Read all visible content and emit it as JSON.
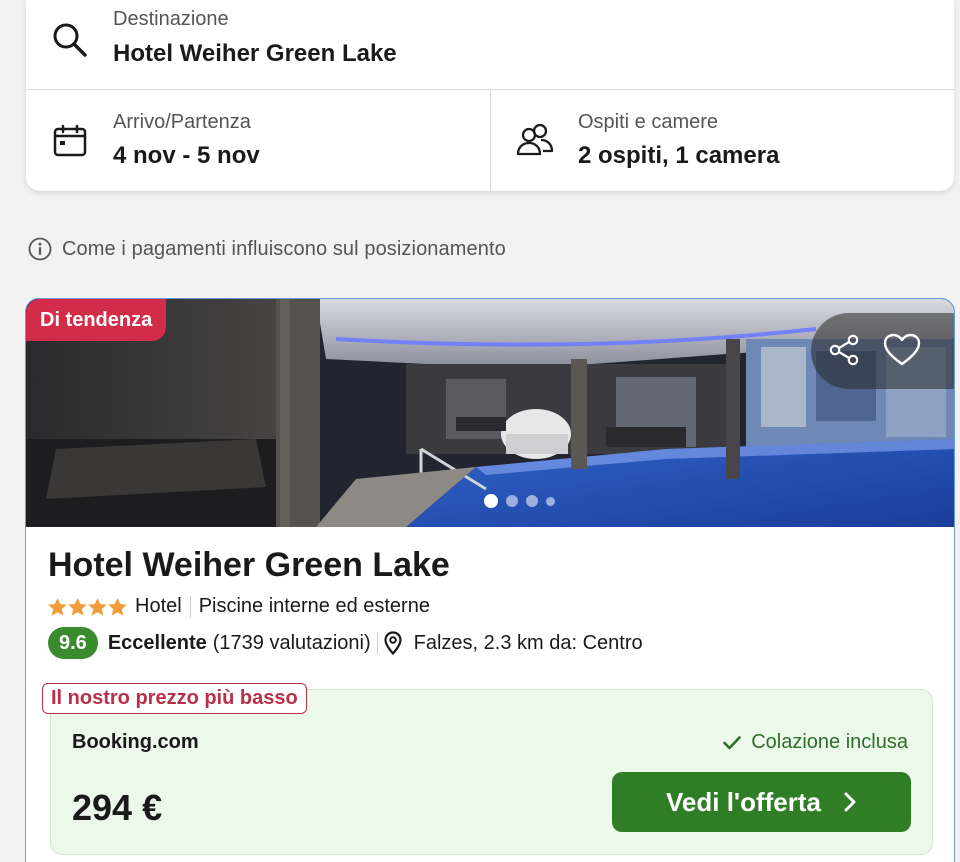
{
  "search": {
    "destination_label": "Destinazione",
    "destination_value": "Hotel Weiher Green Lake",
    "dates_label": "Arrivo/Partenza",
    "dates_value": "4 nov - 5 nov",
    "guests_label": "Ospiti e camere",
    "guests_value": "2 ospiti, 1 camera"
  },
  "info_text": "Come i pagamenti influiscono sul posizionamento",
  "hotel": {
    "badge": "Di tendenza",
    "name": "Hotel Weiher Green Lake",
    "stars": 4,
    "type": "Hotel",
    "feature": "Piscine interne ed esterne",
    "score": "9.6",
    "rating_word": "Eccellente",
    "reviews": "(1739 valutazioni)",
    "location": "Falzes, 2.3 km da: Centro",
    "gallery": {
      "total": 4,
      "active_index": 0
    }
  },
  "offer": {
    "badge": "Il nostro prezzo più basso",
    "provider": "Booking.com",
    "amenity": "Colazione inclusa",
    "price": "294 €",
    "cta": "Vedi l'offerta"
  },
  "colors": {
    "accent_green": "#2f7d24",
    "score_green": "#3a8a2e",
    "badge_red": "#d32c48",
    "offer_bg": "#ebf8ea",
    "star_orange": "#f39c3a"
  }
}
